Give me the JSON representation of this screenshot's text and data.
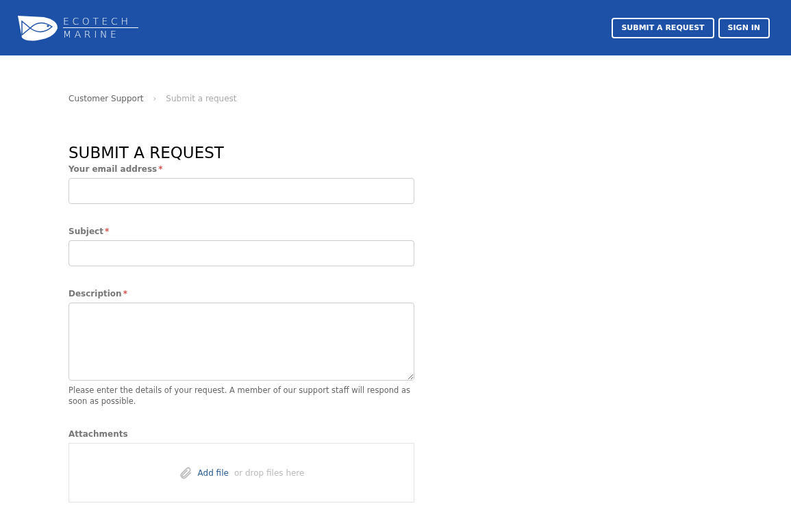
{
  "header": {
    "logo": {
      "line_1": "ECOTECH",
      "line_2": "MARINE"
    },
    "buttons": [
      "SUBMIT A REQUEST",
      "SIGN IN"
    ]
  },
  "breadcrumb": [
    {
      "label": "Customer Support",
      "current": false
    },
    {
      "label": "Submit a request",
      "current": true
    }
  ],
  "breadcrumb_separator": "›",
  "title": "SUBMIT A REQUEST",
  "fields": [
    {
      "kind": "text",
      "label": "Your email address",
      "required_mark": "*"
    },
    {
      "kind": "text",
      "label": "Subject",
      "required_mark": "*"
    },
    {
      "kind": "textarea",
      "label": "Description",
      "required_mark": "*",
      "hint": "Please enter the details of your request. A member of our support staff will respond as soon as possible."
    },
    {
      "kind": "attachments",
      "label": "Attachments",
      "link": "Add file",
      "drop_text": "or drop files here"
    }
  ]
}
